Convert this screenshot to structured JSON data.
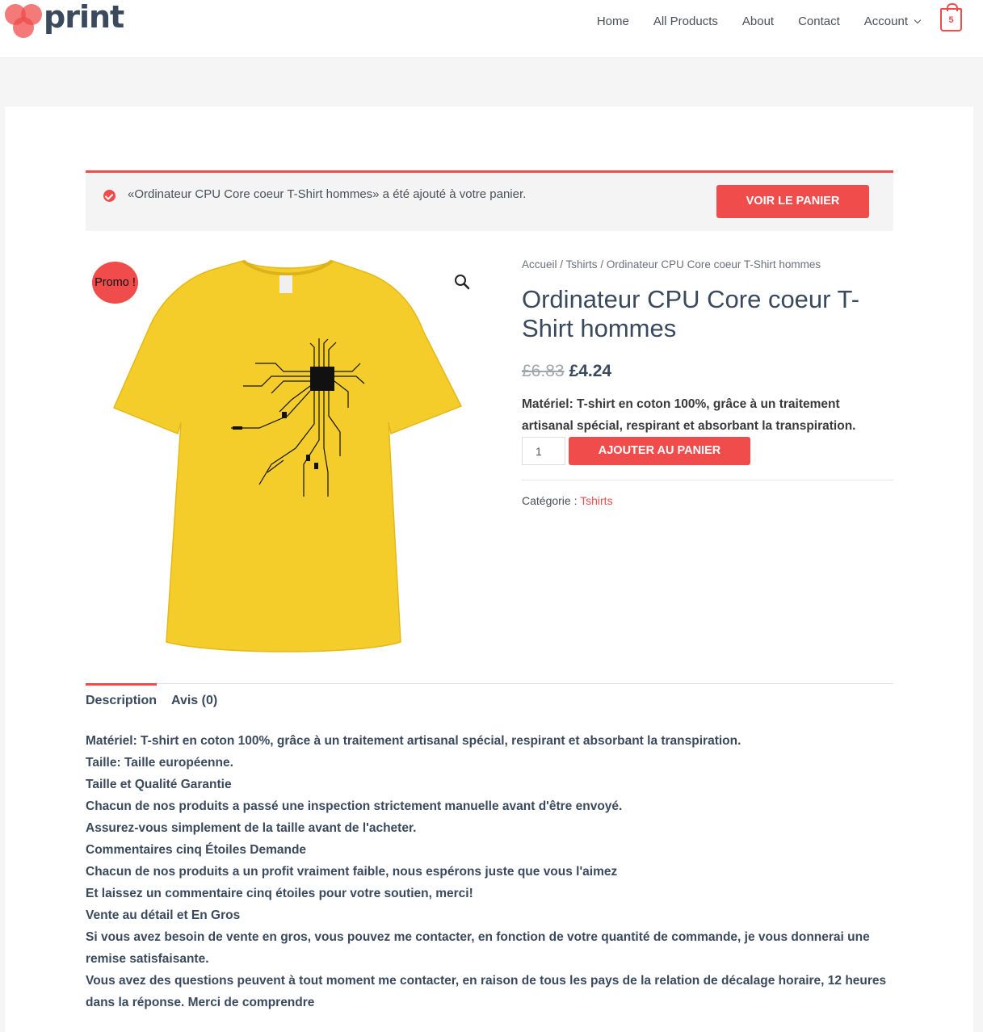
{
  "header": {
    "logo_text": "print",
    "nav": {
      "home": "Home",
      "all_products": "All Products",
      "about": "About",
      "contact": "Contact",
      "account": "Account"
    },
    "cart_count": "5"
  },
  "notice": {
    "message": "«Ordinateur CPU Core coeur T-Shirt hommes» a été ajouté à votre panier.",
    "button": "VOIR LE PANIER"
  },
  "product": {
    "promo_badge": "Promo !",
    "breadcrumb": {
      "home": "Accueil",
      "sep1": " / ",
      "category": "Tshirts",
      "sep2": " / ",
      "current": "Ordinateur CPU Core coeur T-Shirt hommes"
    },
    "title": "Ordinateur CPU Core coeur T-Shirt hommes",
    "old_price": "£6.83",
    "new_price": "£4.24",
    "short_description": "Matériel: T-shirt en coton 100%, grâce à un traitement artisanal spécial, respirant et absorbant la transpiration.",
    "quantity": "1",
    "add_to_cart": "AJOUTER AU PANIER",
    "category_label": "Catégorie : ",
    "category_value": "Tshirts",
    "shirt_color": "#f5cd2a"
  },
  "tabs": {
    "description": "Description",
    "reviews": "Avis (0)"
  },
  "description_lines": [
    "Matériel: T-shirt en coton 100%, grâce à un traitement artisanal spécial, respirant et absorbant la transpiration.",
    "Taille: Taille européenne.",
    "Taille et Qualité Garantie",
    "Chacun de nos produits a passé une inspection strictement manuelle avant d'être envoyé.",
    "Assurez-vous simplement de la taille avant de l'acheter.",
    "Commentaires cinq Étoiles Demande",
    "Chacun de nos produits a un profit vraiment faible, nous espérons juste que vous l'aimez",
    "Et laissez un commentaire cinq étoiles pour votre soutien, merci!",
    "Vente au détail et En Gros",
    "Si vous avez besoin de vente en gros, vous pouvez me contacter, en fonction de votre quantité de commande, je vous donnerai une remise satisfaisante.",
    "Vous avez des questions peuvent à tout moment me contacter, en raison de tous les pays de la relation de décalage horaire, 12 heures dans la réponse. Merci de comprendre"
  ],
  "colors": {
    "accent": "#f04c4c",
    "heading": "#3a4a5c"
  }
}
